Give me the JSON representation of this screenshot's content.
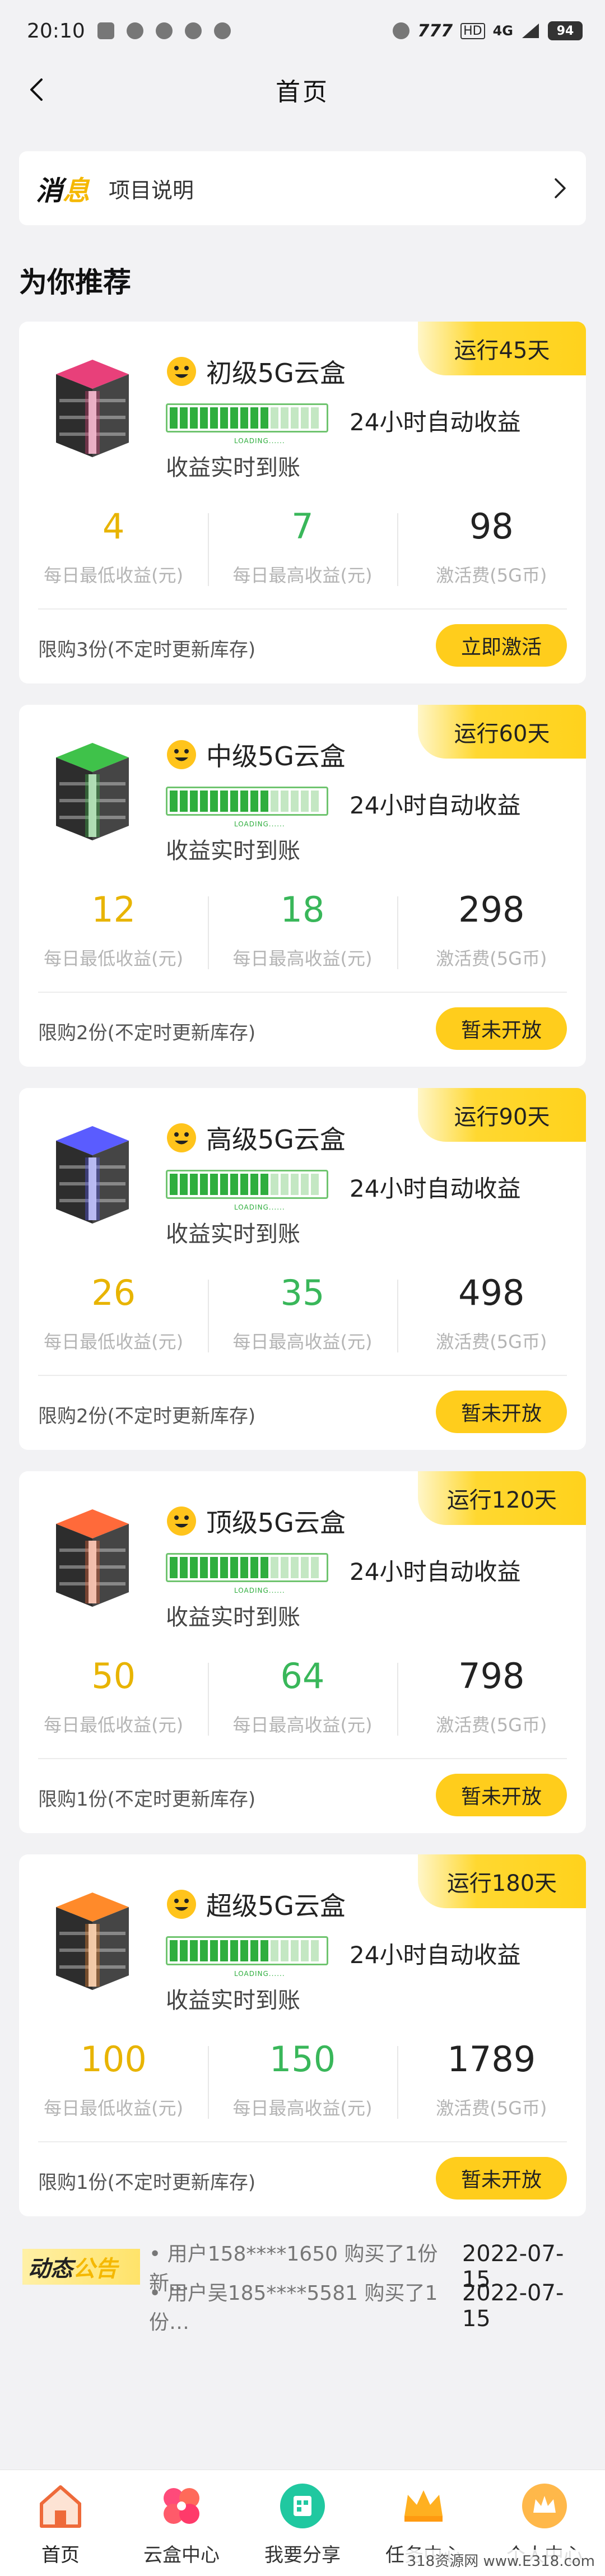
{
  "status_bar": {
    "time": "20:10",
    "network": "4G",
    "signal_text": "777",
    "hd": "HD",
    "battery": "94"
  },
  "header": {
    "title": "首页"
  },
  "notice": {
    "logo_main": "消",
    "logo_accent": "息",
    "text": "项目说明"
  },
  "section_title": "为你推荐",
  "common": {
    "auto_income": "24小时自动收益",
    "realtime": "收益实时到账",
    "loading": "LOADING......",
    "min_label": "每日最低收益(元)",
    "max_label": "每日最高收益(元)",
    "fee_label": "激活费(5G币)"
  },
  "products": [
    {
      "badge": "运行45天",
      "name": "初级5G云盒",
      "min": "4",
      "max": "7",
      "fee": "98",
      "limit": "限购3份(不定时更新库存)",
      "button": "立即激活",
      "color": "#e8407a"
    },
    {
      "badge": "运行60天",
      "name": "中级5G云盒",
      "min": "12",
      "max": "18",
      "fee": "298",
      "limit": "限购2份(不定时更新库存)",
      "button": "暂未开放",
      "color": "#3fc24a"
    },
    {
      "badge": "运行90天",
      "name": "高级5G云盒",
      "min": "26",
      "max": "35",
      "fee": "498",
      "limit": "限购2份(不定时更新库存)",
      "button": "暂未开放",
      "color": "#5a5cff"
    },
    {
      "badge": "运行120天",
      "name": "顶级5G云盒",
      "min": "50",
      "max": "64",
      "fee": "798",
      "limit": "限购1份(不定时更新库存)",
      "button": "暂未开放",
      "color": "#ff6a3a"
    },
    {
      "badge": "运行180天",
      "name": "超级5G云盒",
      "min": "100",
      "max": "150",
      "fee": "1789",
      "limit": "限购1份(不定时更新库存)",
      "button": "暂未开放",
      "color": "#ff8a2a"
    }
  ],
  "announcements": {
    "tag_main": "动态",
    "tag_accent": "公告",
    "items": [
      {
        "text": "• 用户158****1650 购买了1份新…",
        "date": "2022-07-15"
      },
      {
        "text": "• 用户吴185****5581 购买了1份…",
        "date": "2022-07-15"
      }
    ]
  },
  "bottom_nav": [
    {
      "label": "首页",
      "icon": "home-icon"
    },
    {
      "label": "云盒中心",
      "icon": "clover-icon"
    },
    {
      "label": "我要分享",
      "icon": "qr-share-icon"
    },
    {
      "label": "任务中心",
      "icon": "crown-icon"
    },
    {
      "label": "个人中心",
      "icon": "profile-crown-icon"
    }
  ],
  "watermark": "318资源网 www.E318.com"
}
